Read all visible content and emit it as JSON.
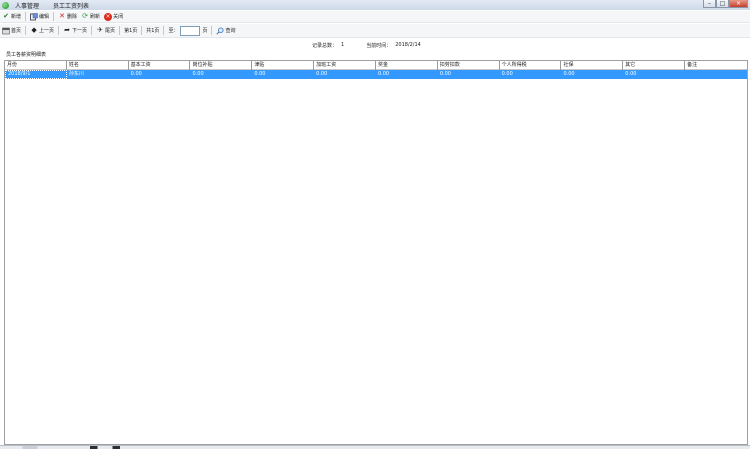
{
  "window": {
    "title": "人事管理",
    "subtitle": "员工工资列表",
    "min_glyph": "–",
    "max_glyph": "□",
    "close_glyph": "×"
  },
  "toolbar1": {
    "items": [
      {
        "icon": "check-icon",
        "label": "新增",
        "color": "#2b7a2b"
      },
      {
        "icon": "edit-icon",
        "label": "编辑",
        "color": "#335599"
      },
      {
        "icon": "delete-icon",
        "label": "删除",
        "color": "#cc2222"
      },
      {
        "icon": "refresh-icon",
        "label": "刷新",
        "color": "#2e9a3a"
      },
      {
        "icon": "close-icon",
        "label": "关闭",
        "color": "#dd2a1a"
      }
    ]
  },
  "toolbar2": {
    "first": "首页",
    "prev": "上一页",
    "next": "下一页",
    "last": "尾页",
    "page_current": "第1页",
    "page_total": "共1页",
    "goto_label": "至：",
    "goto_value": "",
    "goto_suffix": "页",
    "search": "查询"
  },
  "info": {
    "record_label": "记录总数：",
    "record_value": "1",
    "date_label": "当前时间：",
    "date_value": "2018/2/14"
  },
  "caption": "员工各薪资明细表",
  "grid": {
    "columns": [
      "月份",
      "姓名",
      "基本工资",
      "岗位补贴",
      "津贴",
      "加班工资",
      "奖金",
      "扣劳扣款",
      "个人所得税",
      "社保",
      "其它",
      "备注"
    ],
    "rows": [
      [
        "2018/9/1",
        "孙东川",
        "0.00",
        "0.00",
        "0.00",
        "0.00",
        "0.00",
        "0.00",
        "0.00",
        "0.00",
        "0.00",
        ""
      ]
    ],
    "selected_row_color": "#3399ff"
  },
  "status": {
    "text": ""
  }
}
